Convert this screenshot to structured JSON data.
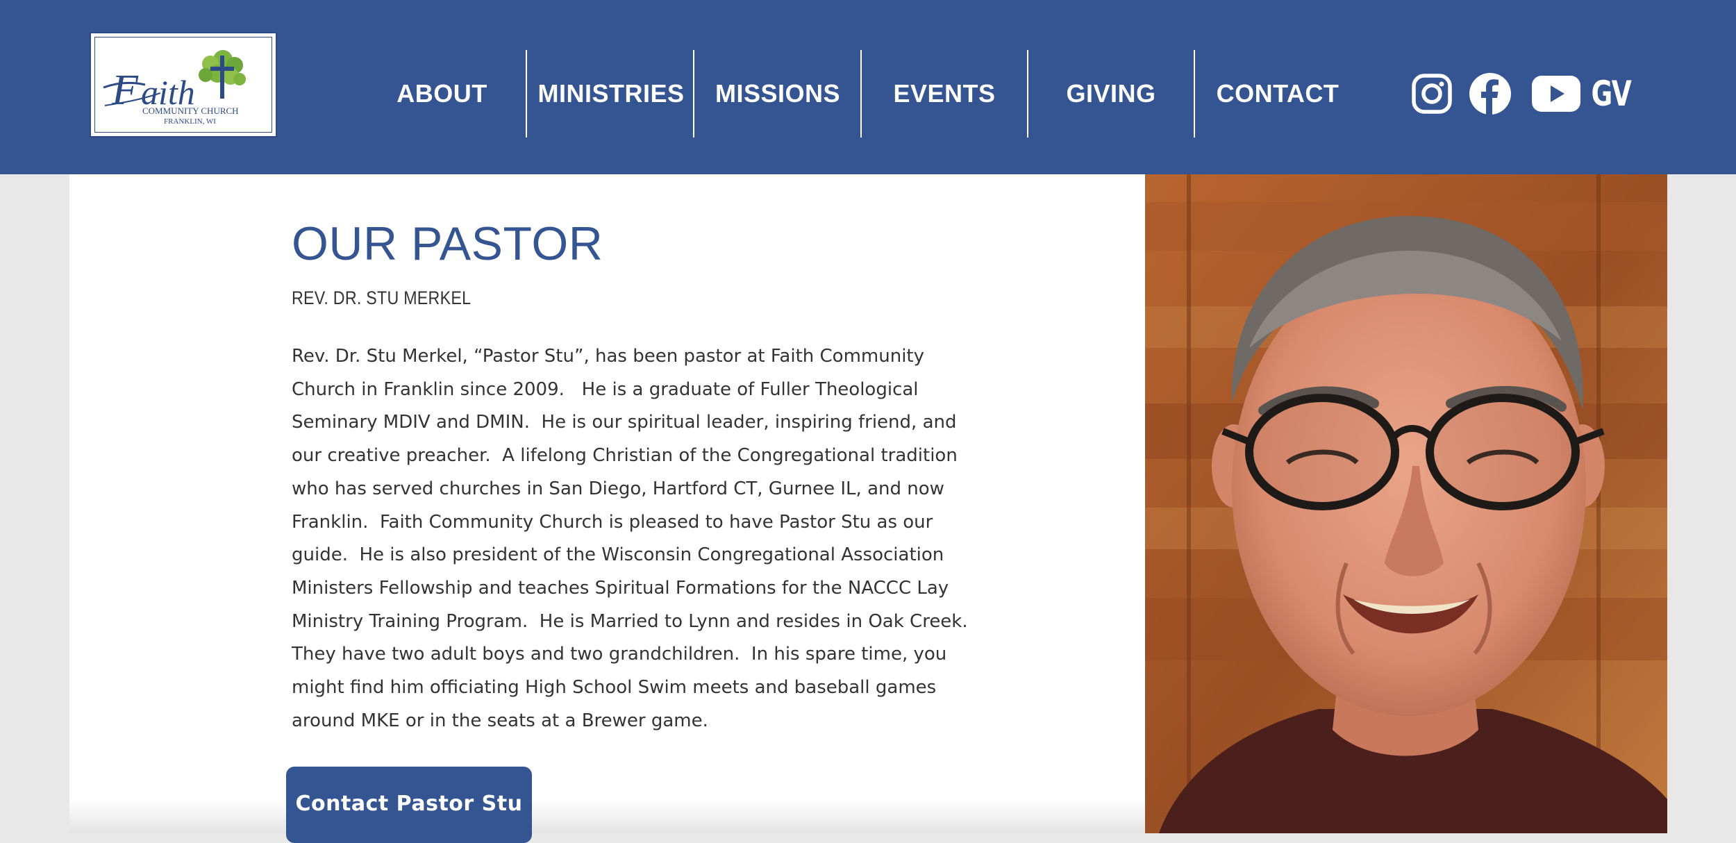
{
  "header": {
    "logo": {
      "wordmark": "FAITH",
      "line1": "COMMUNITY CHURCH",
      "line2": "FRANKLIN, WI"
    },
    "nav": [
      {
        "label": "ABOUT"
      },
      {
        "label": "MINISTRIES"
      },
      {
        "label": "MISSIONS"
      },
      {
        "label": "EVENTS"
      },
      {
        "label": "GIVING"
      },
      {
        "label": "CONTACT"
      }
    ],
    "social": [
      {
        "icon": "instagram-icon"
      },
      {
        "icon": "facebook-icon"
      },
      {
        "icon": "youtube-icon"
      },
      {
        "icon": "gv-icon",
        "label": "GV"
      }
    ]
  },
  "main": {
    "title": "OUR PASTOR",
    "subtitle": "REV. DR. STU MERKEL",
    "bio_lines": [
      "Rev. Dr. Stu Merkel, “Pastor Stu”, has been pastor at Faith Community",
      "Church in Franklin since 2009.   He is a graduate of Fuller Theological",
      "Seminary MDIV and DMIN.  He is our spiritual leader, inspiring friend, and",
      "our creative preacher.  A lifelong Christian of the Congregational tradition",
      "who has served churches in San Diego, Hartford CT, Gurnee IL, and now",
      "Franklin.  Faith Community Church is pleased to have Pastor Stu as our",
      "guide.  He is also president of the Wisconsin Congregational Association",
      "Ministers Fellowship and teaches Spiritual Formations for the NACCC Lay",
      "Ministry Training Program.  He is Married to Lynn and resides in Oak Creek.",
      "They have two adult boys and two grandchildren.  In his spare time, you",
      "might find him officiating High School Swim meets and baseball games",
      "around MKE or in the seats at a Brewer game."
    ],
    "cta_label": "Contact Pastor Stu"
  },
  "colors": {
    "brand_blue": "#355592",
    "logo_green": "#7db33f",
    "text": "#333333"
  }
}
